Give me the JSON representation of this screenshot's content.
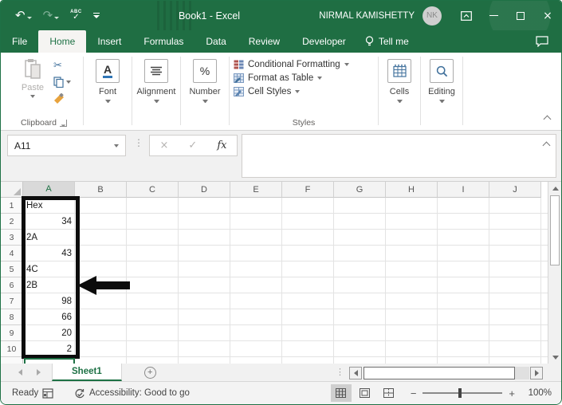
{
  "titlebar": {
    "title": "Book1 - Excel",
    "user_name": "NIRMAL KAMISHETTY",
    "avatar_initials": "NK"
  },
  "qat": {
    "undo_glyph": "↶",
    "redo_glyph": "↷",
    "spell_abc": "ABC",
    "spell_check": "✓"
  },
  "tab_bar": {
    "tabs": [
      "File",
      "Home",
      "Insert",
      "Formulas",
      "Data",
      "Review",
      "Developer"
    ],
    "active_tab": "Home",
    "tell_me": "Tell me"
  },
  "ribbon": {
    "clipboard": {
      "paste_label": "Paste",
      "group_label": "Clipboard",
      "scissors_glyph": "✂"
    },
    "font_group": {
      "label": "Font",
      "icon_letter": "A"
    },
    "alignment_group": {
      "label": "Alignment"
    },
    "number_group": {
      "label": "Number",
      "icon_symbol": "%"
    },
    "styles_group": {
      "label": "Styles",
      "items": [
        "Conditional Formatting",
        "Format as Table",
        "Cell Styles"
      ]
    },
    "cells_group": {
      "label": "Cells"
    },
    "editing_group": {
      "label": "Editing"
    }
  },
  "formula_bar": {
    "name_box_value": "A11",
    "cancel_glyph": "×",
    "enter_glyph": "✓",
    "fx_label": "fx",
    "dots_glyph": "⋮"
  },
  "grid": {
    "columns": [
      "A",
      "B",
      "C",
      "D",
      "E",
      "F",
      "G",
      "H",
      "I",
      "J"
    ],
    "rows": [
      "1",
      "2",
      "3",
      "4",
      "5",
      "6",
      "7",
      "8",
      "9",
      "10"
    ],
    "selected_column": "A",
    "active_cell": "A11",
    "cells": [
      {
        "row": "1",
        "value": "Hex",
        "align": "left"
      },
      {
        "row": "2",
        "value": "34",
        "align": "right"
      },
      {
        "row": "3",
        "value": "2A",
        "align": "left"
      },
      {
        "row": "4",
        "value": "43",
        "align": "right"
      },
      {
        "row": "5",
        "value": "4C",
        "align": "left"
      },
      {
        "row": "6",
        "value": "2B",
        "align": "left"
      },
      {
        "row": "7",
        "value": "98",
        "align": "right"
      },
      {
        "row": "8",
        "value": "66",
        "align": "right"
      },
      {
        "row": "9",
        "value": "20",
        "align": "right"
      },
      {
        "row": "10",
        "value": "2",
        "align": "right"
      }
    ],
    "annotations": {
      "boxed_range": "A1:A10",
      "arrow_points_at_row": "6"
    }
  },
  "sheet_bar": {
    "sheet_name": "Sheet1",
    "add_sheet_glyph": "+",
    "dots_glyph": "⋮"
  },
  "status_bar": {
    "mode": "Ready",
    "accessibility_text": "Accessibility: Good to go",
    "zoom_minus": "−",
    "zoom_plus": "+",
    "zoom_level": "100%"
  },
  "colors": {
    "excel_green": "#1f6e43",
    "selection_green": "#1e7145",
    "annotation_black": "#0c0c0c",
    "font_underline_blue": "#2e75b6"
  }
}
